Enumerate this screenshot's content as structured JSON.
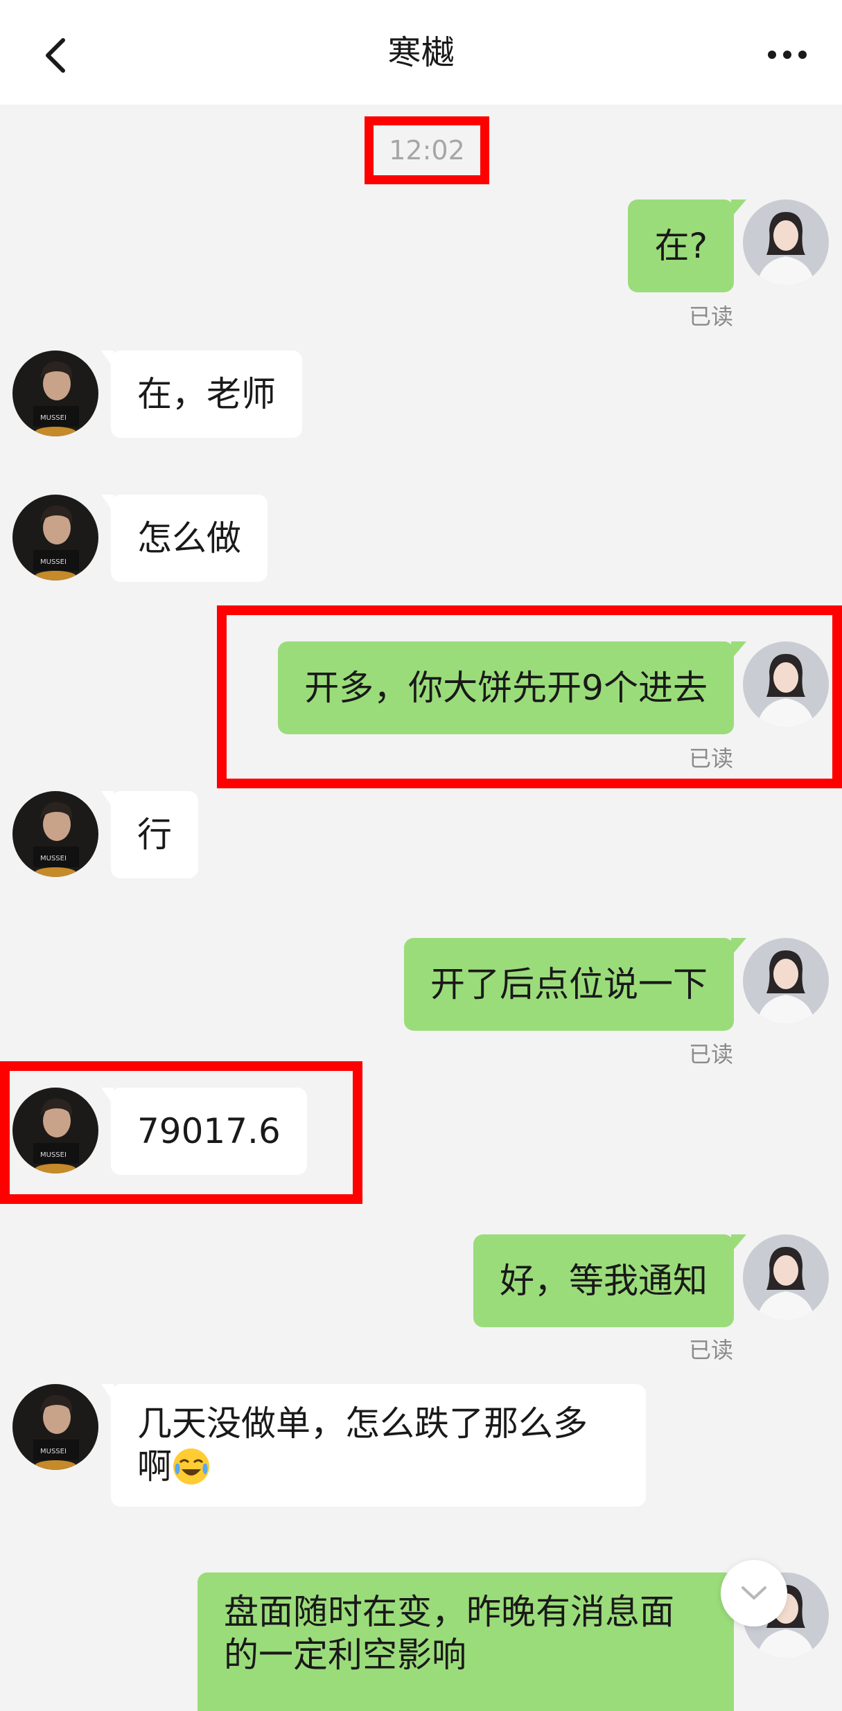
{
  "header": {
    "title": "寒樾"
  },
  "timestamp": "12:02",
  "messages": [
    {
      "side": "out",
      "text": "在?",
      "status": "已读"
    },
    {
      "side": "in",
      "text": "在，老师"
    },
    {
      "side": "in",
      "text": "怎么做"
    },
    {
      "side": "out",
      "text": "开多，你大饼先开9个进去",
      "status": "已读"
    },
    {
      "side": "in",
      "text": "行"
    },
    {
      "side": "out",
      "text": "开了后点位说一下",
      "status": "已读"
    },
    {
      "side": "in",
      "text": "79017.6"
    },
    {
      "side": "out",
      "text": "好，等我通知",
      "status": "已读"
    },
    {
      "side": "in",
      "text_line1": "几天没做单，怎么跌了那么多",
      "text_line2": "啊",
      "emoji": "face-with-tears-of-joy-icon"
    },
    {
      "side": "out",
      "text_line1": "盘面随时在变，昨晚有消息面",
      "text_line2": "的一定利空影响"
    }
  ],
  "colors": {
    "background": "#f3f3f3",
    "outgoing_bubble": "#9bdc7a",
    "incoming_bubble": "#ffffff",
    "highlight": "#ff0000"
  }
}
